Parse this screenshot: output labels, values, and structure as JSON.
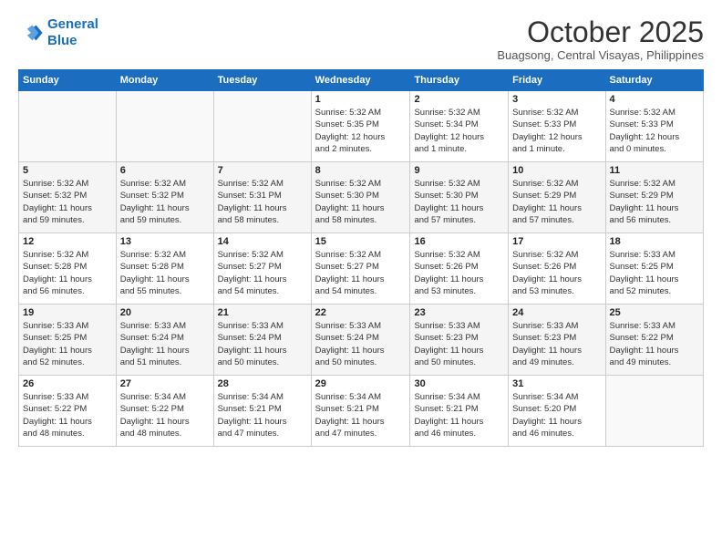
{
  "header": {
    "logo_line1": "General",
    "logo_line2": "Blue",
    "month": "October 2025",
    "location": "Buagsong, Central Visayas, Philippines"
  },
  "days_of_week": [
    "Sunday",
    "Monday",
    "Tuesday",
    "Wednesday",
    "Thursday",
    "Friday",
    "Saturday"
  ],
  "weeks": [
    [
      {
        "day": "",
        "info": ""
      },
      {
        "day": "",
        "info": ""
      },
      {
        "day": "",
        "info": ""
      },
      {
        "day": "1",
        "info": "Sunrise: 5:32 AM\nSunset: 5:35 PM\nDaylight: 12 hours\nand 2 minutes."
      },
      {
        "day": "2",
        "info": "Sunrise: 5:32 AM\nSunset: 5:34 PM\nDaylight: 12 hours\nand 1 minute."
      },
      {
        "day": "3",
        "info": "Sunrise: 5:32 AM\nSunset: 5:33 PM\nDaylight: 12 hours\nand 1 minute."
      },
      {
        "day": "4",
        "info": "Sunrise: 5:32 AM\nSunset: 5:33 PM\nDaylight: 12 hours\nand 0 minutes."
      }
    ],
    [
      {
        "day": "5",
        "info": "Sunrise: 5:32 AM\nSunset: 5:32 PM\nDaylight: 11 hours\nand 59 minutes."
      },
      {
        "day": "6",
        "info": "Sunrise: 5:32 AM\nSunset: 5:32 PM\nDaylight: 11 hours\nand 59 minutes."
      },
      {
        "day": "7",
        "info": "Sunrise: 5:32 AM\nSunset: 5:31 PM\nDaylight: 11 hours\nand 58 minutes."
      },
      {
        "day": "8",
        "info": "Sunrise: 5:32 AM\nSunset: 5:30 PM\nDaylight: 11 hours\nand 58 minutes."
      },
      {
        "day": "9",
        "info": "Sunrise: 5:32 AM\nSunset: 5:30 PM\nDaylight: 11 hours\nand 57 minutes."
      },
      {
        "day": "10",
        "info": "Sunrise: 5:32 AM\nSunset: 5:29 PM\nDaylight: 11 hours\nand 57 minutes."
      },
      {
        "day": "11",
        "info": "Sunrise: 5:32 AM\nSunset: 5:29 PM\nDaylight: 11 hours\nand 56 minutes."
      }
    ],
    [
      {
        "day": "12",
        "info": "Sunrise: 5:32 AM\nSunset: 5:28 PM\nDaylight: 11 hours\nand 56 minutes."
      },
      {
        "day": "13",
        "info": "Sunrise: 5:32 AM\nSunset: 5:28 PM\nDaylight: 11 hours\nand 55 minutes."
      },
      {
        "day": "14",
        "info": "Sunrise: 5:32 AM\nSunset: 5:27 PM\nDaylight: 11 hours\nand 54 minutes."
      },
      {
        "day": "15",
        "info": "Sunrise: 5:32 AM\nSunset: 5:27 PM\nDaylight: 11 hours\nand 54 minutes."
      },
      {
        "day": "16",
        "info": "Sunrise: 5:32 AM\nSunset: 5:26 PM\nDaylight: 11 hours\nand 53 minutes."
      },
      {
        "day": "17",
        "info": "Sunrise: 5:32 AM\nSunset: 5:26 PM\nDaylight: 11 hours\nand 53 minutes."
      },
      {
        "day": "18",
        "info": "Sunrise: 5:33 AM\nSunset: 5:25 PM\nDaylight: 11 hours\nand 52 minutes."
      }
    ],
    [
      {
        "day": "19",
        "info": "Sunrise: 5:33 AM\nSunset: 5:25 PM\nDaylight: 11 hours\nand 52 minutes."
      },
      {
        "day": "20",
        "info": "Sunrise: 5:33 AM\nSunset: 5:24 PM\nDaylight: 11 hours\nand 51 minutes."
      },
      {
        "day": "21",
        "info": "Sunrise: 5:33 AM\nSunset: 5:24 PM\nDaylight: 11 hours\nand 50 minutes."
      },
      {
        "day": "22",
        "info": "Sunrise: 5:33 AM\nSunset: 5:24 PM\nDaylight: 11 hours\nand 50 minutes."
      },
      {
        "day": "23",
        "info": "Sunrise: 5:33 AM\nSunset: 5:23 PM\nDaylight: 11 hours\nand 50 minutes."
      },
      {
        "day": "24",
        "info": "Sunrise: 5:33 AM\nSunset: 5:23 PM\nDaylight: 11 hours\nand 49 minutes."
      },
      {
        "day": "25",
        "info": "Sunrise: 5:33 AM\nSunset: 5:22 PM\nDaylight: 11 hours\nand 49 minutes."
      }
    ],
    [
      {
        "day": "26",
        "info": "Sunrise: 5:33 AM\nSunset: 5:22 PM\nDaylight: 11 hours\nand 48 minutes."
      },
      {
        "day": "27",
        "info": "Sunrise: 5:34 AM\nSunset: 5:22 PM\nDaylight: 11 hours\nand 48 minutes."
      },
      {
        "day": "28",
        "info": "Sunrise: 5:34 AM\nSunset: 5:21 PM\nDaylight: 11 hours\nand 47 minutes."
      },
      {
        "day": "29",
        "info": "Sunrise: 5:34 AM\nSunset: 5:21 PM\nDaylight: 11 hours\nand 47 minutes."
      },
      {
        "day": "30",
        "info": "Sunrise: 5:34 AM\nSunset: 5:21 PM\nDaylight: 11 hours\nand 46 minutes."
      },
      {
        "day": "31",
        "info": "Sunrise: 5:34 AM\nSunset: 5:20 PM\nDaylight: 11 hours\nand 46 minutes."
      },
      {
        "day": "",
        "info": ""
      }
    ]
  ]
}
